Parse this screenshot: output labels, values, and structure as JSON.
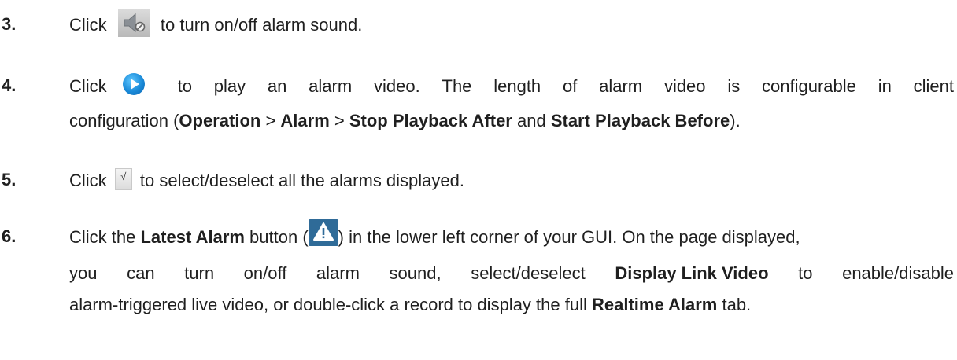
{
  "steps": [
    {
      "number": "3.",
      "before_icon": "Click",
      "icon": "speaker-mute-icon",
      "after_icon": "to turn on/off alarm sound."
    },
    {
      "number": "4.",
      "line1": {
        "before_icon": "Click",
        "icon": "play-icon",
        "words": [
          "to",
          "play",
          "an",
          "alarm",
          "video.",
          "The",
          "length",
          "of",
          "alarm",
          "video",
          "is",
          "configurable",
          "in",
          "client"
        ]
      },
      "line2": {
        "t1": "configuration (",
        "b1": "Operation",
        "t2": " > ",
        "b2": "Alarm",
        "t3": " > ",
        "b3": "Stop Playback After",
        "t4": " and ",
        "b4": "Start Playback Before",
        "t5": ")."
      }
    },
    {
      "number": "5.",
      "before_icon": "Click",
      "icon": "select-all-checkbox-icon",
      "icon_glyph": "√",
      "after_icon": "to select/deselect all the alarms displayed."
    },
    {
      "number": "6.",
      "line1": {
        "t1": "Click the ",
        "b1": "Latest Alarm",
        "t2": " button (",
        "icon": "warning-icon",
        "t3": ") in the lower left corner of your GUI. On the page displayed,"
      },
      "line2": {
        "words": [
          "you",
          "can",
          "turn",
          "on/off",
          "alarm",
          "sound,",
          "select/deselect"
        ],
        "bold": "Display Link Video",
        "words_after": [
          "to",
          "enable/disable"
        ]
      },
      "line3": {
        "t1": "alarm-triggered live video, or double-click a record to display the full ",
        "b1": "Realtime Alarm",
        "t2": " tab."
      }
    }
  ]
}
